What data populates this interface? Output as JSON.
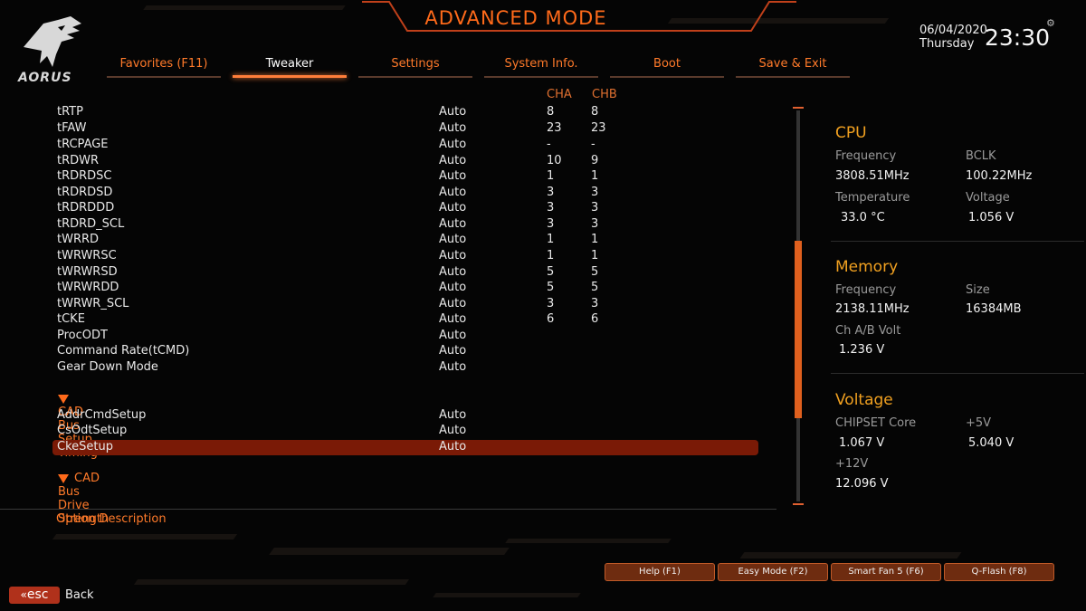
{
  "header": {
    "brand": "AORUS",
    "title": "ADVANCED MODE",
    "date": "06/04/2020",
    "day": "Thursday",
    "time": "23:30"
  },
  "tabs": [
    {
      "label": "Favorites (F11)"
    },
    {
      "label": "Tweaker"
    },
    {
      "label": "Settings"
    },
    {
      "label": "System Info."
    },
    {
      "label": "Boot"
    },
    {
      "label": "Save & Exit"
    }
  ],
  "active_tab": "Tweaker",
  "columns": {
    "cha": "CHA",
    "chb": "CHB"
  },
  "rows": [
    {
      "name": "tRTP",
      "value": "Auto",
      "cha": "8",
      "chb": "8"
    },
    {
      "name": "tFAW",
      "value": "Auto",
      "cha": "23",
      "chb": "23"
    },
    {
      "name": "tRCPAGE",
      "value": "Auto",
      "cha": "-",
      "chb": "-"
    },
    {
      "name": "tRDWR",
      "value": "Auto",
      "cha": "10",
      "chb": "9"
    },
    {
      "name": "tRDRDSC",
      "value": "Auto",
      "cha": "1",
      "chb": "1"
    },
    {
      "name": "tRDRDSD",
      "value": "Auto",
      "cha": "3",
      "chb": "3"
    },
    {
      "name": "tRDRDDD",
      "value": "Auto",
      "cha": "3",
      "chb": "3"
    },
    {
      "name": "tRDRD_SCL",
      "value": "Auto",
      "cha": "3",
      "chb": "3"
    },
    {
      "name": "tWRRD",
      "value": "Auto",
      "cha": "1",
      "chb": "1"
    },
    {
      "name": "tWRWRSC",
      "value": "Auto",
      "cha": "1",
      "chb": "1"
    },
    {
      "name": "tWRWRSD",
      "value": "Auto",
      "cha": "5",
      "chb": "5"
    },
    {
      "name": "tWRWRDD",
      "value": "Auto",
      "cha": "5",
      "chb": "5"
    },
    {
      "name": "tWRWR_SCL",
      "value": "Auto",
      "cha": "3",
      "chb": "3"
    },
    {
      "name": "tCKE",
      "value": "Auto",
      "cha": "6",
      "chb": "6"
    },
    {
      "name": "ProcODT",
      "value": "Auto",
      "cha": "",
      "chb": ""
    },
    {
      "name": "Command Rate(tCMD)",
      "value": "Auto",
      "cha": "",
      "chb": ""
    },
    {
      "name": "Gear Down Mode",
      "value": "Auto",
      "cha": "",
      "chb": ""
    }
  ],
  "cad_timing": {
    "title": "CAD Bus Setup Timing",
    "rows": [
      {
        "name": "AddrCmdSetup",
        "value": "Auto"
      },
      {
        "name": "CsOdtSetup",
        "value": "Auto"
      },
      {
        "name": "CkeSetup",
        "value": "Auto"
      }
    ]
  },
  "cad_drive": {
    "title": "CAD Bus Drive Strength"
  },
  "option_description": "Option Description",
  "panel": {
    "cpu": {
      "title": "CPU",
      "freq_label": "Frequency",
      "freq": "3808.51MHz",
      "bclk_label": "BCLK",
      "bclk": "100.22MHz",
      "temp_label": "Temperature",
      "temp": "33.0 °C",
      "volt_label": "Voltage",
      "volt": "1.056 V"
    },
    "memory": {
      "title": "Memory",
      "freq_label": "Frequency",
      "freq": "2138.11MHz",
      "size_label": "Size",
      "size": "16384MB",
      "volt_label": "Ch A/B Volt",
      "volt": "1.236 V"
    },
    "voltage": {
      "title": "Voltage",
      "chipset_label": "CHIPSET Core",
      "chipset": "1.067 V",
      "p5v_label": "+5V",
      "p5v": "5.040 V",
      "p12v_label": "+12V",
      "p12v": "12.096 V"
    }
  },
  "footer": {
    "help": "Help (F1)",
    "easy": "Easy Mode (F2)",
    "fan": "Smart Fan 5 (F6)",
    "qflash": "Q-Flash (F8)",
    "esc": "esc",
    "back": "Back"
  },
  "colors": {
    "accent": "#ff6a1a",
    "panel_heading": "#f0a020",
    "selected_row": "#7a1a06"
  }
}
